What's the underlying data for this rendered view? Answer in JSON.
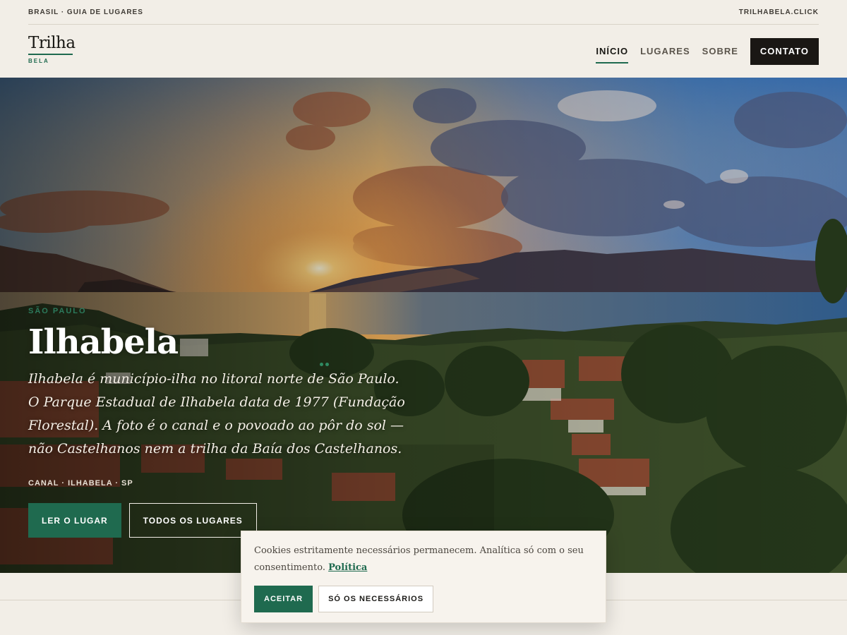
{
  "topbar": {
    "left_label": "BRASIL · GUIA DE LUGARES",
    "right_label": "TRILHABELA.CLICK"
  },
  "brand": {
    "name": "Trilha",
    "subtitle": "BELA"
  },
  "nav": {
    "items": [
      {
        "label": "INÍCIO",
        "active": true
      },
      {
        "label": "LUGARES",
        "active": false
      },
      {
        "label": "SOBRE",
        "active": false
      }
    ],
    "contact_label": "CONTATO"
  },
  "hero": {
    "eyebrow": "SÃO PAULO",
    "title": "Ilhabela",
    "description": "Ilhabela é município-ilha no litoral norte de São Paulo. O Parque Estadual de Ilhabela data de 1977 (Fundação Florestal). A foto é o canal e o povoado ao pôr do sol — não Castelhanos nem a trilha da Baía dos Castelhanos.",
    "meta": "CANAL · ILHABELA · SP",
    "primary_button": "LER O LUGAR",
    "secondary_button": "TODOS OS LUGARES"
  },
  "cookie": {
    "text": "Cookies estritamente necessários permanecem. Analítica só com o seu consentimento.",
    "link_label": "Política",
    "accept_label": "ACEITAR",
    "necessary_label": "SÓ OS NECESSÁRIOS"
  },
  "colors": {
    "accent": "#1f6a4f",
    "dark": "#1a1714",
    "paper": "#f2eee7"
  },
  "icons": {
    "carousel_dots": "carousel-dots-icon"
  }
}
